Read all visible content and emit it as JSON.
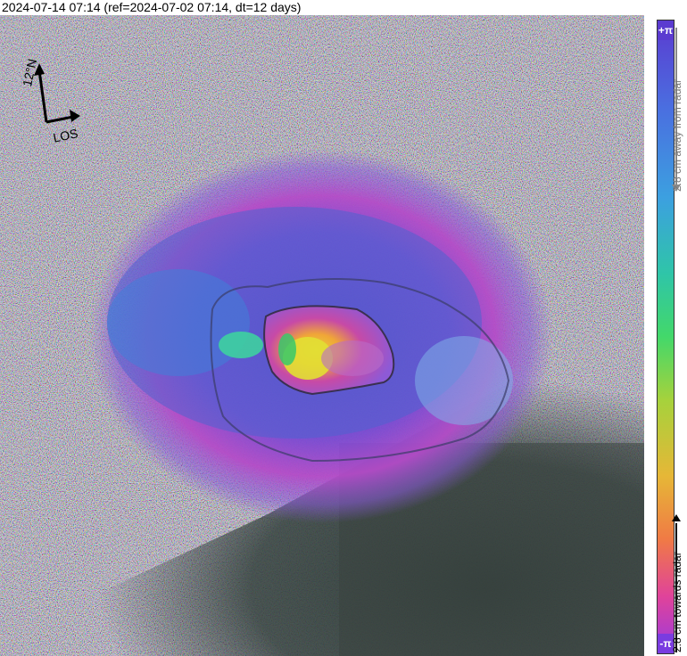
{
  "header": {
    "title": "2024-07-14 07:14 (ref=2024-07-02 07:14, dt=12 days)"
  },
  "compass": {
    "north_label": "12°N",
    "los_label": "LOS"
  },
  "colorbar": {
    "top_symbol": "+π",
    "bottom_symbol": "-π",
    "away_label": "2.8 cm away from radar",
    "towards_label": "2.8 cm towards radar",
    "colors": [
      "#5b3bd0",
      "#4a6fe0",
      "#3ca0e0",
      "#2fc5a8",
      "#43d86a",
      "#a6d23c",
      "#e6b737",
      "#f07a45",
      "#e0439a",
      "#9a3ae0"
    ]
  },
  "map": {
    "features": [
      "background-noise",
      "deformation-ring",
      "crater-rim",
      "caldera-floor",
      "dark-terrain-southeast"
    ]
  }
}
